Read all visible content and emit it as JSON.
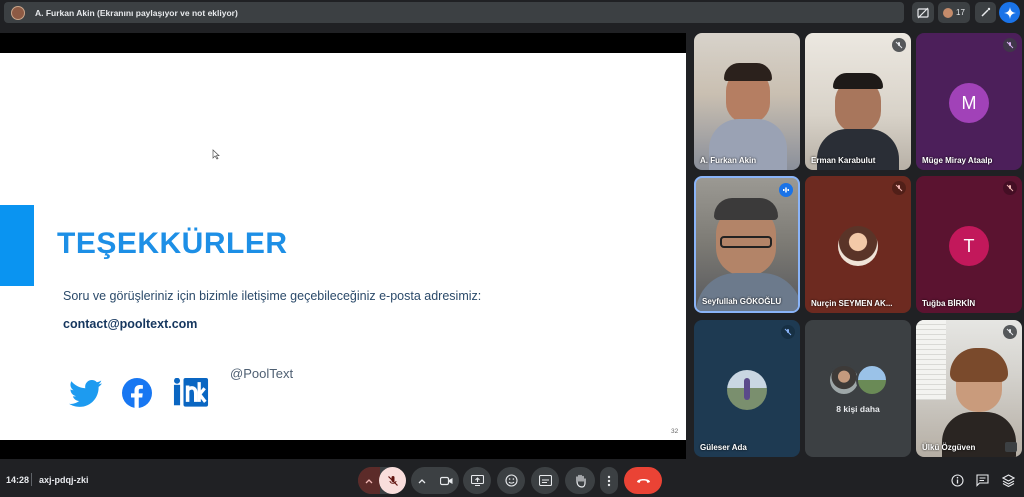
{
  "top_bar": {
    "presenter_label": "A. Furkan Akin (Ekranını paylaşıyor ve not ekliyor)",
    "participant_count": "17"
  },
  "slide": {
    "title": "TEŞEKKÜRLER",
    "line": "Soru ve görüşleriniz için bizimle iletişime geçebileceğiniz e-posta adresimiz:",
    "email": "contact@pooltext.com",
    "handle": "@PoolText",
    "page_number": "32",
    "accent_color": "#0a94f1",
    "title_color": "#1d8fe6"
  },
  "participants": [
    {
      "name": "A. Furkan Akin",
      "kind": "video",
      "muted": false
    },
    {
      "name": "Erman Karabulut",
      "kind": "video",
      "muted": true
    },
    {
      "name": "Müge Miray Ataalp",
      "kind": "avatar",
      "letter": "M",
      "color": "#a142b8",
      "muted": true
    },
    {
      "name": "Seyfullah GÖKOĞLU",
      "kind": "video",
      "speaking": true
    },
    {
      "name": "Nurçin SEYMEN AK...",
      "kind": "photo-avatar",
      "muted": true
    },
    {
      "name": "Tuğba BİRKİN",
      "kind": "avatar",
      "letter": "T",
      "color": "#c2185b",
      "muted": true
    },
    {
      "name": "Güleser Ada",
      "kind": "photo-avatar",
      "muted": true
    },
    {
      "name": "8 kişi daha",
      "kind": "more"
    },
    {
      "name": "Ülkü Özgüven",
      "kind": "video",
      "muted": true
    }
  ],
  "bottom_bar": {
    "time": "14:28",
    "meeting_code": "axj-pdqj-zki",
    "end_call_color": "#ea4335"
  }
}
